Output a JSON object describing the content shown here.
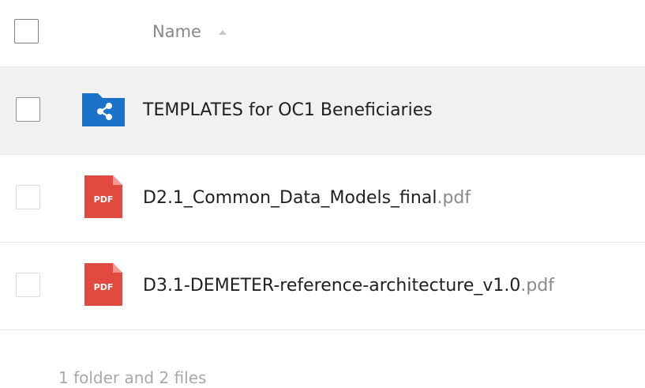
{
  "header": {
    "column_label": "Name",
    "sort_direction": "ascending"
  },
  "files": [
    {
      "type": "shared-folder",
      "name": "TEMPLATES for OC1 Beneficiaries",
      "extension": "",
      "icon": "shared-folder-icon",
      "hovered": true
    },
    {
      "type": "pdf",
      "name": "D2.1_Common_Data_Models_final",
      "extension": ".pdf",
      "icon": "pdf-file-icon",
      "icon_label": "PDF",
      "hovered": false
    },
    {
      "type": "pdf",
      "name": "D3.1-DEMETER-reference-architecture_v1.0",
      "extension": ".pdf",
      "icon": "pdf-file-icon",
      "icon_label": "PDF",
      "hovered": false
    }
  ],
  "summary": "1 folder and 2 files",
  "colors": {
    "folder_blue": "#1a73c9",
    "pdf_red": "#e04a3f",
    "hover_bg": "#f1f1f1"
  }
}
